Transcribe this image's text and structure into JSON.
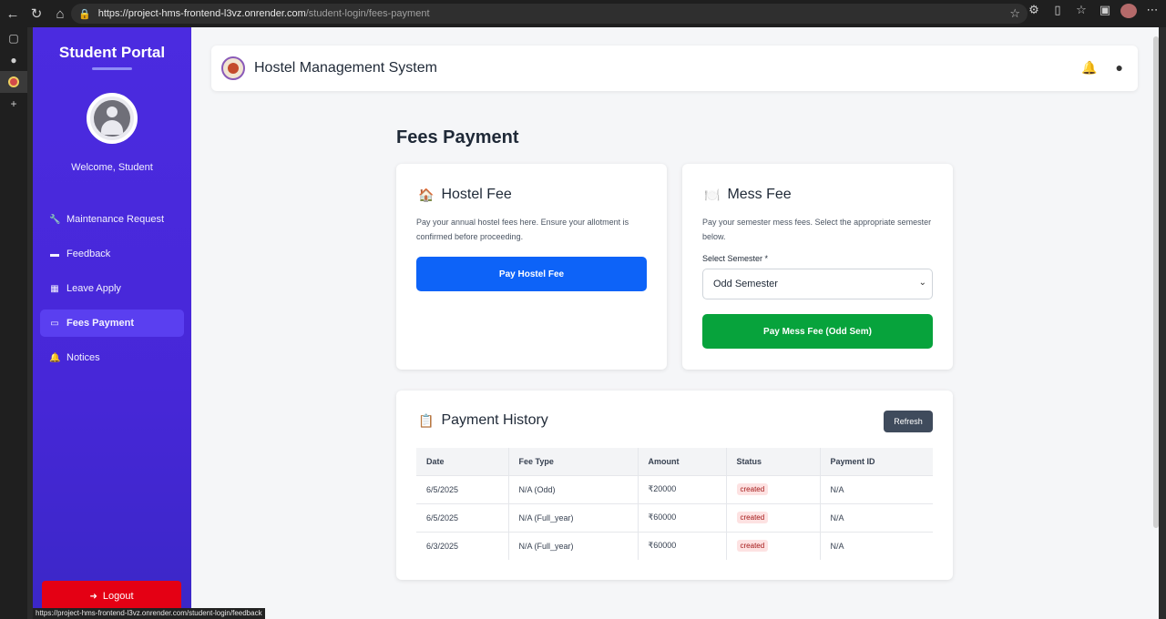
{
  "browser": {
    "url_host": "https://project-hms-frontend-l3vz.onrender.com",
    "url_path": "/student-login/fees-payment",
    "status_url": "https://project-hms-frontend-l3vz.onrender.com/student-login/feedback"
  },
  "sidebar": {
    "brand": "Student Portal",
    "welcome": "Welcome, Student",
    "items": [
      {
        "label": "Maintenance Request",
        "icon": "wrench-icon",
        "glyph": "🔧"
      },
      {
        "label": "Feedback",
        "icon": "comment-icon",
        "glyph": "▬"
      },
      {
        "label": "Leave Apply",
        "icon": "calendar-icon",
        "glyph": "▦"
      },
      {
        "label": "Fees Payment",
        "icon": "credit-card-icon",
        "glyph": "▭"
      },
      {
        "label": "Notices",
        "icon": "bell-icon",
        "glyph": "🔔"
      }
    ],
    "active_item": "Fees Payment",
    "logout": "Logout"
  },
  "header": {
    "title": "Hostel Management System"
  },
  "main": {
    "page_title": "Fees Payment",
    "hostel": {
      "title": "Hostel Fee",
      "emoji": "🏠",
      "description": "Pay your annual hostel fees here. Ensure your allotment is confirmed before proceeding.",
      "button": "Pay Hostel Fee"
    },
    "mess": {
      "title": "Mess Fee",
      "emoji": "🍽️",
      "description": "Pay your semester mess fees. Select the appropriate semester below.",
      "select_label": "Select Semester *",
      "select_value": "Odd Semester",
      "button": "Pay Mess Fee (Odd Sem)"
    },
    "history": {
      "title": "Payment History",
      "emoji": "📋",
      "refresh": "Refresh",
      "columns": [
        "Date",
        "Fee Type",
        "Amount",
        "Status",
        "Payment ID"
      ],
      "rows": [
        {
          "date": "6/5/2025",
          "fee_type": "N/A (Odd)",
          "amount": "₹20000",
          "status": "created",
          "payment_id": "N/A"
        },
        {
          "date": "6/5/2025",
          "fee_type": "N/A (Full_year)",
          "amount": "₹60000",
          "status": "created",
          "payment_id": "N/A"
        },
        {
          "date": "6/3/2025",
          "fee_type": "N/A (Full_year)",
          "amount": "₹60000",
          "status": "created",
          "payment_id": "N/A"
        }
      ]
    }
  },
  "colors": {
    "sidebar_bg": "#4b2be0",
    "primary_blue": "#0d63f8",
    "success_green": "#07a33c",
    "danger_red": "#e40014",
    "badge_bg": "#fde2e2"
  }
}
